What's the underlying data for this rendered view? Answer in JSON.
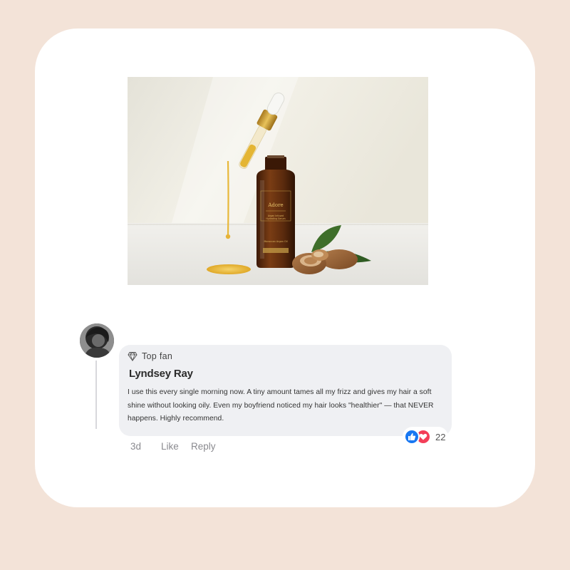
{
  "comment": {
    "badge": {
      "icon": "diamond-icon",
      "label": "Top fan"
    },
    "author": "Lyndsey Ray",
    "text": "I use this every single morning now. A tiny amount tames all my frizz and gives my hair a soft shine without looking oily. Even my boyfriend noticed my hair looks \"healthier\" — that NEVER happens. Highly recommend.",
    "reactions": {
      "icons": [
        "like-icon",
        "love-icon"
      ],
      "count": "22"
    },
    "actions": {
      "time": "3d",
      "like": "Like",
      "reply": "Reply"
    }
  },
  "product": {
    "label_brand": "Adore",
    "label_line1": "Argan Infused",
    "label_line2": "Hydrating Serum",
    "label_bottom": "Moroccan Argan Oil"
  },
  "colors": {
    "background": "#f3e3d8",
    "card": "#ffffff",
    "bubble": "#eff0f3",
    "like_blue": "#1877f2",
    "love_red": "#f33e58",
    "bottle_amber": "#5a2c10",
    "oil_gold": "#e8b83a"
  }
}
